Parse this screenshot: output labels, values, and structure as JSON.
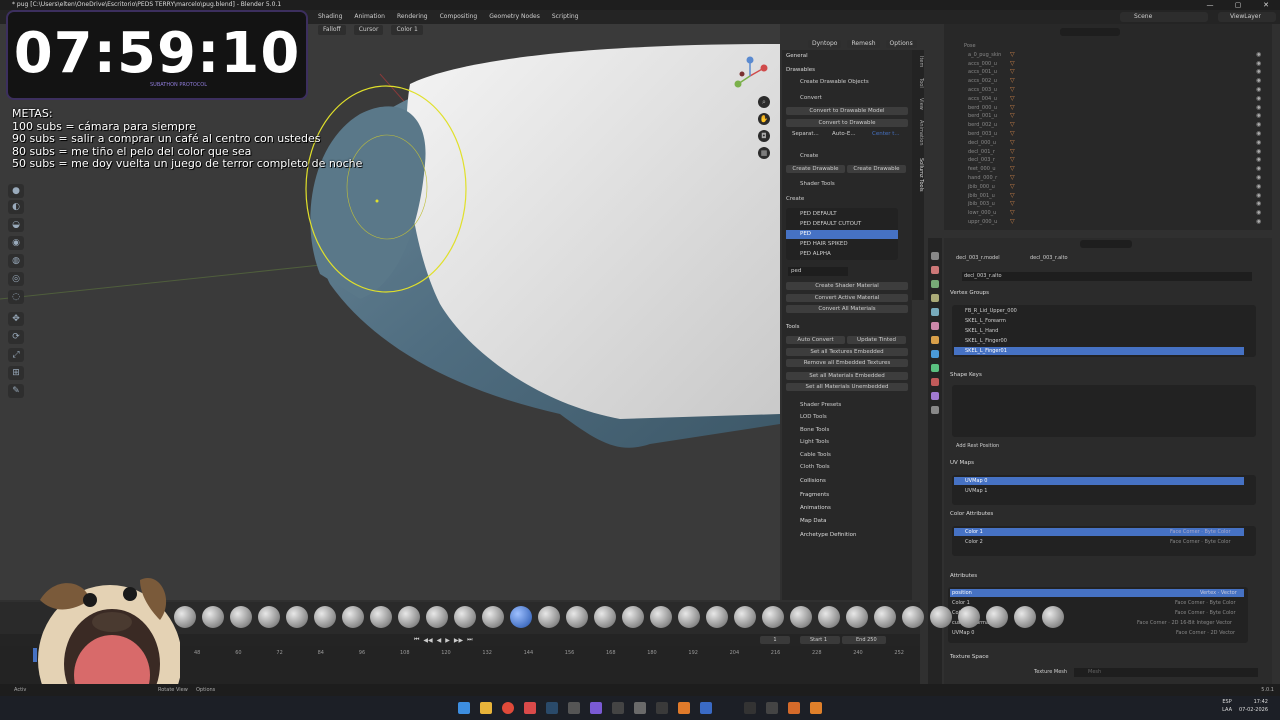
{
  "window": {
    "title": "* pug [C:\\Users\\elten\\OneDrive\\Escritorio\\PEDS TERRY\\marcelo\\pug.blend] - Blender 5.0.1",
    "workspaces": [
      "Shading",
      "Animation",
      "Rendering",
      "Compositing",
      "Geometry Nodes",
      "Scripting"
    ],
    "scene": "Scene",
    "view_layer": "ViewLayer"
  },
  "viewport": {
    "falloff": "Falloff",
    "cursor": "Cursor",
    "color_attr": "Color 1",
    "dyntopo": "Dyntopo",
    "remesh": "Remesh",
    "options": "Options"
  },
  "overlay": {
    "timer": "07:59:10",
    "timer_sub": "SUBATHON PROTOCOL",
    "metas_title": "METAS:",
    "metas": [
      "100 subs = cámara para siempre",
      "90 subs = salir a comprar un café al centro con ustedes",
      "80 subs = me tiño el pelo del color que sea",
      "50 subs = me doy vuelta un juego de terror completo de noche"
    ]
  },
  "npanel": {
    "general": "General",
    "drawables": "Drawables",
    "create_drawable_objects": "Create Drawable Objects",
    "convert": "Convert",
    "convert_to_drawable_model": "Convert to Drawable Model",
    "convert_to_drawable": "Convert to Drawable",
    "separate": "Separat...",
    "auto_e": "Auto-E...",
    "center": "Center t...",
    "create": "Create",
    "create_drawable_1": "Create Drawable",
    "create_drawable_2": "Create Drawable",
    "shader_tools": "Shader Tools",
    "create_label": "Create",
    "shaders": [
      "PED DEFAULT",
      "PED DEFAULT CUTOUT",
      "PED",
      "PED HAIR SPIKED",
      "PED ALPHA"
    ],
    "selected_shader": "PED",
    "filter": "ped",
    "create_shader_material": "Create Shader Material",
    "convert_active_material": "Convert Active Material",
    "convert_all_materials": "Convert All Materials",
    "tools": "Tools",
    "auto_convert": "Auto Convert",
    "update_tinted": "Update Tinted",
    "set_all_textures_embedded": "Set all Textures Embedded",
    "remove_all_embedded_textures": "Remove all Embedded Textures",
    "set_all_materials_embedded": "Set all Materials Embedded",
    "set_all_materials_unembedded": "Set all Materials Unembedded",
    "subsections": [
      "Shader Presets",
      "LOD Tools",
      "Bone Tools",
      "Light Tools",
      "Cable Tools",
      "Cloth Tools"
    ],
    "sections": [
      "Collisions",
      "Fragments",
      "Animations",
      "Map Data",
      "Archetype Definition"
    ],
    "side_tabs": [
      "Item",
      "Tool",
      "View",
      "Animation",
      "Sollumz Tools"
    ]
  },
  "outliner": {
    "items": [
      "Pose",
      "a_0_pug_skin",
      "accs_000_u",
      "accs_001_u",
      "accs_002_u",
      "accs_003_u",
      "accs_004_u",
      "berd_000_u",
      "berd_001_u",
      "berd_002_u",
      "berd_003_u",
      "decl_000_u",
      "decl_001_r",
      "decl_003_r",
      "feet_000_u",
      "hand_000_r",
      "jbib_000_u",
      "jbib_001_u",
      "jbib_003_u",
      "lowr_000_u",
      "uppr_000_u"
    ]
  },
  "properties": {
    "breadcrumb_model": "decl_003_r.model",
    "breadcrumb_mesh": "decl_003_r.alto",
    "mesh_name": "decl_003_r.alto",
    "vertex_groups_title": "Vertex Groups",
    "vertex_groups": [
      "FB_R_Lid_Upper_000",
      "SKEL_L_Forearm",
      "SKEL_L_Hand",
      "SKEL_L_Finger00",
      "SKEL_L_Finger01"
    ],
    "selected_vertex_group": "SKEL_L_Finger01",
    "shape_keys_title": "Shape Keys",
    "add_rest_position": "Add Rest Position",
    "uv_maps_title": "UV Maps",
    "uv_maps": [
      "UVMap 0",
      "UVMap 1"
    ],
    "color_attributes_title": "Color Attributes",
    "color_attributes": [
      {
        "name": "Color 1",
        "info": "Face Corner · Byte Color"
      },
      {
        "name": "Color 2",
        "info": "Face Corner · Byte Color"
      }
    ],
    "attributes_title": "Attributes",
    "attributes": [
      {
        "name": "position",
        "info": "Vertex · Vector"
      },
      {
        "name": "Color 1",
        "info": "Face Corner · Byte Color"
      },
      {
        "name": "Color 2",
        "info": "Face Corner · Byte Color"
      },
      {
        "name": "custom_normal",
        "info": "Face Corner · 2D 16-Bit Integer Vector"
      },
      {
        "name": "UVMap 0",
        "info": "Face Corner · 2D Vector"
      }
    ],
    "texture_space_title": "Texture Space",
    "texture_mesh_label": "Texture Mesh",
    "texture_mesh_placeholder": "Mesh"
  },
  "timeline": {
    "current_frame": "1",
    "start_label": "Start",
    "start_value": "1",
    "end_label": "End",
    "end_value": "250",
    "ticks": [
      "48",
      "60",
      "72",
      "84",
      "96",
      "108",
      "120",
      "132",
      "144",
      "156",
      "168",
      "180",
      "192",
      "204",
      "216",
      "228",
      "240",
      "252"
    ]
  },
  "status": {
    "activate": "Activ",
    "rotate_view": "Rotate View",
    "options": "Options",
    "version": "5.0.1"
  },
  "taskbar": {
    "lang": "ESP",
    "lang2": "LAA",
    "time": "17:42",
    "date": "07-02-2026"
  },
  "colors": {
    "accent": "#4672c4",
    "brush_circle": "#e0e02a",
    "timer": "#ffffff",
    "denim": "#5b7a8c"
  }
}
